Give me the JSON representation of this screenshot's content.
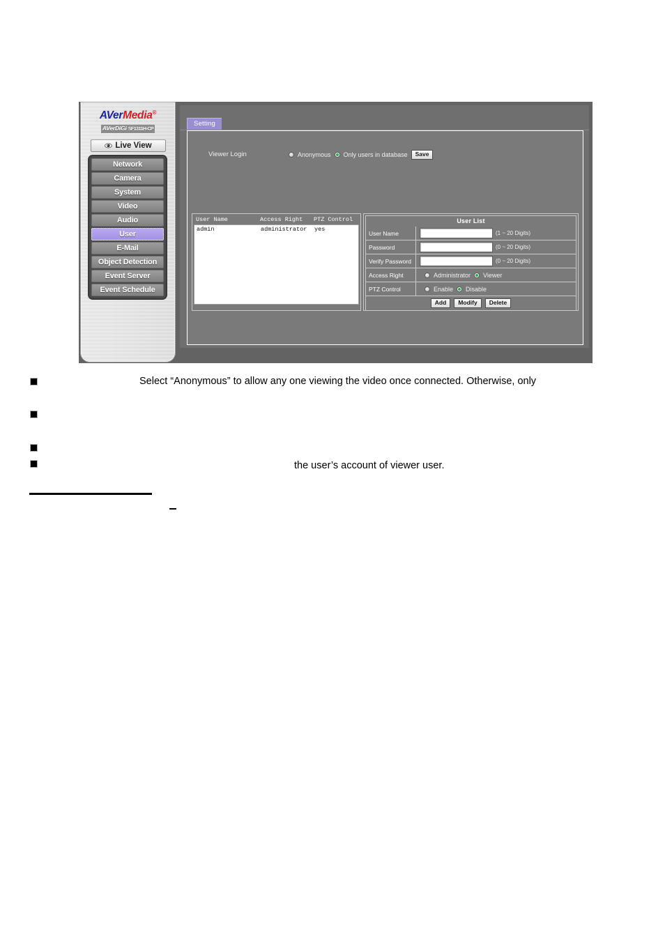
{
  "device_ui": {
    "brand": {
      "name_a": "AVer",
      "name_b": "Media",
      "sub_brand": "AVerDiGi",
      "model": "SF1311H-CP"
    },
    "live_view_label": "Live View",
    "nav_items": [
      {
        "label": "Network",
        "selected": false
      },
      {
        "label": "Camera",
        "selected": false
      },
      {
        "label": "System",
        "selected": false
      },
      {
        "label": "Video",
        "selected": false
      },
      {
        "label": "Audio",
        "selected": false
      },
      {
        "label": "User",
        "selected": true
      },
      {
        "label": "E-Mail",
        "selected": false
      },
      {
        "label": "Object Detection",
        "selected": false
      },
      {
        "label": "Event Server",
        "selected": false
      },
      {
        "label": "Event Schedule",
        "selected": false
      }
    ],
    "tab": {
      "label": "Setting",
      "color": "#9a8ed2"
    },
    "viewer_login": {
      "label": "Viewer Login",
      "option_anonymous": "Anonymous",
      "option_database": "Only users in database",
      "selected": "Only users in database",
      "save_label": "Save"
    },
    "user_table": {
      "columns": [
        "User Name",
        "Access Right",
        "PTZ Control"
      ],
      "rows": [
        {
          "user_name": "admin",
          "access_right": "administrator",
          "ptz_control": "yes"
        }
      ]
    },
    "user_form": {
      "title": "User List",
      "fields": [
        {
          "label": "User Name",
          "value": "",
          "hint": "(1 ~ 20 Digits)"
        },
        {
          "label": "Password",
          "value": "",
          "hint": "(0 ~ 20 Digits)"
        },
        {
          "label": "Verify Password",
          "value": "",
          "hint": "(0 ~ 20 Digits)"
        }
      ],
      "access_right": {
        "label": "Access Right",
        "option_admin": "Administrator",
        "option_viewer": "Viewer",
        "selected": "Viewer"
      },
      "ptz_control": {
        "label": "PTZ Control",
        "option_enable": "Enable",
        "option_disable": "Disable",
        "selected": "Disable"
      },
      "buttons": {
        "add": "Add",
        "modify": "Modify",
        "delete": "Delete"
      }
    }
  },
  "body_text": {
    "bullet_1": "Select “Anonymous” to allow any one viewing the video once connected. Otherwise, only",
    "bullet_2": "",
    "bullet_3": "",
    "bullet_4": "the user’s account of viewer user."
  }
}
